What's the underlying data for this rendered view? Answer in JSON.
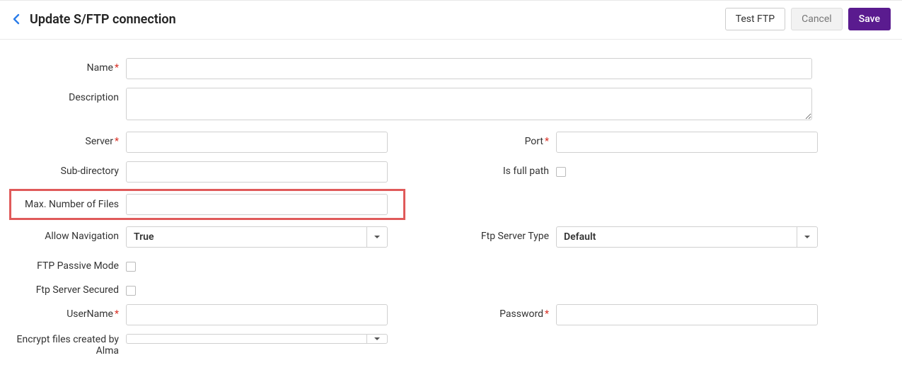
{
  "header": {
    "title": "Update S/FTP connection",
    "test_ftp": "Test FTP",
    "cancel": "Cancel",
    "save": "Save"
  },
  "labels": {
    "name": "Name",
    "description": "Description",
    "server": "Server",
    "port": "Port",
    "sub_directory": "Sub-directory",
    "is_full_path": "Is full path",
    "max_files": "Max. Number of Files",
    "allow_navigation": "Allow Navigation",
    "ftp_server_type": "Ftp Server Type",
    "ftp_passive_mode": "FTP Passive Mode",
    "ftp_server_secured": "Ftp Server Secured",
    "username": "UserName",
    "password": "Password",
    "encrypt_files": "Encrypt files created by Alma"
  },
  "values": {
    "name": "",
    "description": "",
    "server": "",
    "port": "",
    "sub_directory": "",
    "max_files": "",
    "allow_navigation": "True",
    "ftp_server_type": "Default",
    "username": "",
    "password": "",
    "encrypt_files": ""
  }
}
